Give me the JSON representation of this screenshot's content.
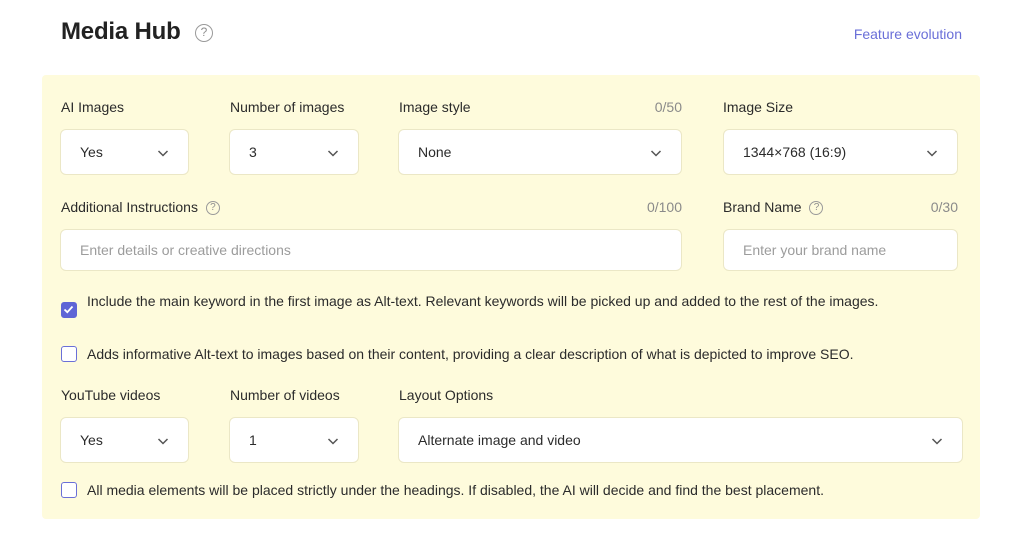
{
  "header": {
    "title": "Media Hub",
    "help_glyph": "?",
    "feature_link": "Feature evolution"
  },
  "images": {
    "ai_images_label": "AI Images",
    "ai_images_value": "Yes",
    "num_images_label": "Number of images",
    "num_images_value": "3",
    "style_label": "Image style",
    "style_counter": "0/50",
    "style_value": "None",
    "size_label": "Image Size",
    "size_value": "1344×768 (16:9)"
  },
  "instructions": {
    "label": "Additional Instructions",
    "counter": "0/100",
    "placeholder": "Enter details or creative directions"
  },
  "brand": {
    "label": "Brand Name",
    "counter": "0/30",
    "placeholder": "Enter your brand name"
  },
  "options": {
    "keyword_alt_text": "Include the main keyword in the first image as Alt-text. Relevant keywords will be picked up and added to the rest of the images.",
    "keyword_alt_checked": true,
    "informative_alt_text": "Adds informative Alt-text to images based on their content, providing a clear description of what is depicted to improve SEO.",
    "informative_alt_checked": false,
    "placement_text": "All media elements will be placed strictly under the headings. If disabled, the AI will decide and find the best placement.",
    "placement_checked": false
  },
  "videos": {
    "youtube_label": "YouTube videos",
    "youtube_value": "Yes",
    "num_videos_label": "Number of videos",
    "num_videos_value": "1",
    "layout_label": "Layout Options",
    "layout_value": "Alternate image and video"
  },
  "colors": {
    "accent": "#5f65d6",
    "link": "#6a6fd8",
    "panel_bg": "#fefbdc"
  },
  "icons": [
    "help-icon",
    "chevron-down-icon",
    "checkmark-icon"
  ]
}
